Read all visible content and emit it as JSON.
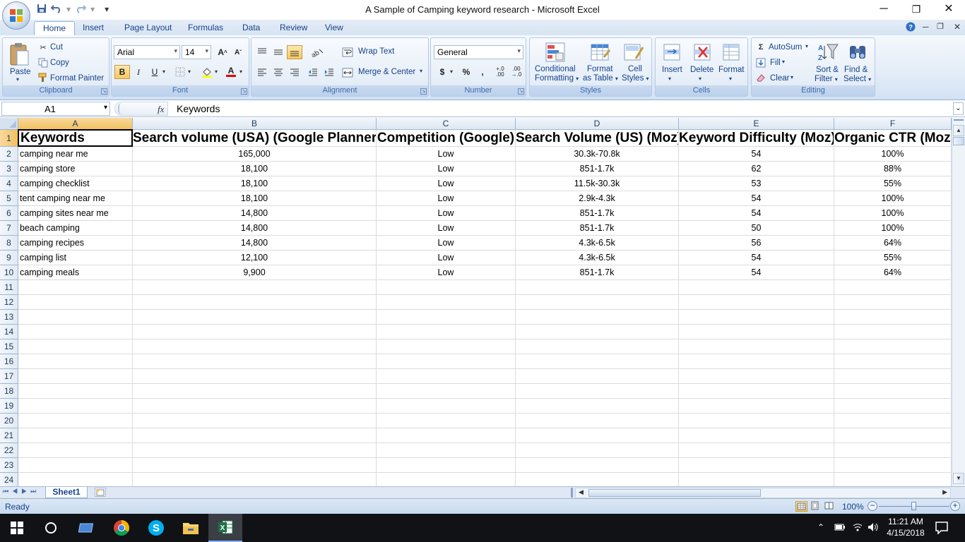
{
  "window": {
    "title": "A Sample of Camping keyword research - Microsoft Excel",
    "minimize_glyph": "─",
    "restore_glyph": "❐",
    "close_glyph": "✕"
  },
  "qat": {
    "save_icon": "save-icon",
    "undo_icon": "undo-icon",
    "redo_icon": "redo-icon",
    "customize_glyph": "▾"
  },
  "tabs": [
    {
      "label": "Home",
      "active": true
    },
    {
      "label": "Insert"
    },
    {
      "label": "Page Layout"
    },
    {
      "label": "Formulas"
    },
    {
      "label": "Data"
    },
    {
      "label": "Review"
    },
    {
      "label": "View"
    }
  ],
  "ribbon": {
    "clipboard": {
      "paste": "Paste",
      "cut": "Cut",
      "copy": "Copy",
      "format_painter": "Format Painter",
      "label": "Clipboard"
    },
    "font": {
      "name": "Arial",
      "size": "14",
      "grow": "A",
      "shrink": "A",
      "bold": "B",
      "italic": "I",
      "underline": "U",
      "font_color_glyph": "A",
      "label": "Font"
    },
    "alignment": {
      "wrap_text": "Wrap Text",
      "merge_center": "Merge & Center",
      "label": "Alignment"
    },
    "number": {
      "format": "General",
      "currency": "$",
      "percent": "%",
      "comma": ",",
      "inc_decimal_a": "+.0",
      "inc_decimal_b": ".00",
      "dec_decimal_a": ".00",
      "dec_decimal_b": "→.0",
      "label": "Number"
    },
    "styles": {
      "conditional_1": "Conditional",
      "conditional_2": "Formatting",
      "format_table_1": "Format",
      "format_table_2": "as Table",
      "cell_styles_1": "Cell",
      "cell_styles_2": "Styles",
      "label": "Styles"
    },
    "cells": {
      "insert": "Insert",
      "delete": "Delete",
      "format": "Format",
      "label": "Cells"
    },
    "editing": {
      "autosum": "AutoSum",
      "fill": "Fill",
      "clear": "Clear",
      "sort_1": "Sort &",
      "sort_2": "Filter",
      "find_1": "Find &",
      "find_2": "Select",
      "label": "Editing"
    }
  },
  "formula_bar": {
    "name_box": "A1",
    "fx": "fx",
    "content": "Keywords"
  },
  "columns": [
    "A",
    "B",
    "C",
    "D",
    "E",
    "F"
  ],
  "header_row": [
    "Keywords",
    "Search volume (USA) (Google Planner)",
    "Competition (Google)",
    "Search Volume (US) (Moz)",
    "Keyword Difficulty (Moz)",
    "Organic CTR (Moz)"
  ],
  "rows": [
    [
      "camping near me",
      "165,000",
      "Low",
      "30.3k-70.8k",
      "54",
      "100%"
    ],
    [
      "camping store",
      "18,100",
      "Low",
      "851-1.7k",
      "62",
      "88%"
    ],
    [
      "camping checklist",
      "18,100",
      "Low",
      "11.5k-30.3k",
      "53",
      "55%"
    ],
    [
      "tent camping near me",
      "18,100",
      "Low",
      "2.9k-4.3k",
      "54",
      "100%"
    ],
    [
      "camping sites near me",
      "14,800",
      "Low",
      "851-1.7k",
      "54",
      "100%"
    ],
    [
      "beach camping",
      "14,800",
      "Low",
      "851-1.7k",
      "50",
      "100%"
    ],
    [
      "camping recipes",
      "14,800",
      "Low",
      "4.3k-6.5k",
      "56",
      "64%"
    ],
    [
      "camping list",
      "12,100",
      "Low",
      "4.3k-6.5k",
      "54",
      "55%"
    ],
    [
      "camping meals",
      "9,900",
      "Low",
      "851-1.7k",
      "54",
      "64%"
    ]
  ],
  "row_numbers": [
    "1",
    "2",
    "3",
    "4",
    "5",
    "6",
    "7",
    "8",
    "9",
    "10",
    "11",
    "12",
    "13",
    "14",
    "15",
    "16",
    "17",
    "18",
    "19",
    "20",
    "21",
    "22",
    "23",
    "24"
  ],
  "sheets": [
    {
      "name": "Sheet1",
      "active": true
    }
  ],
  "status": {
    "ready": "Ready",
    "zoom": "100%"
  },
  "taskbar": {
    "time": "11:21 AM",
    "date": "4/15/2018"
  },
  "colors": {
    "accent": "#15428b",
    "ribbon_bg": "#dfe9f5",
    "selected_header": "#f1c15f",
    "excel_green": "#1e7145"
  }
}
